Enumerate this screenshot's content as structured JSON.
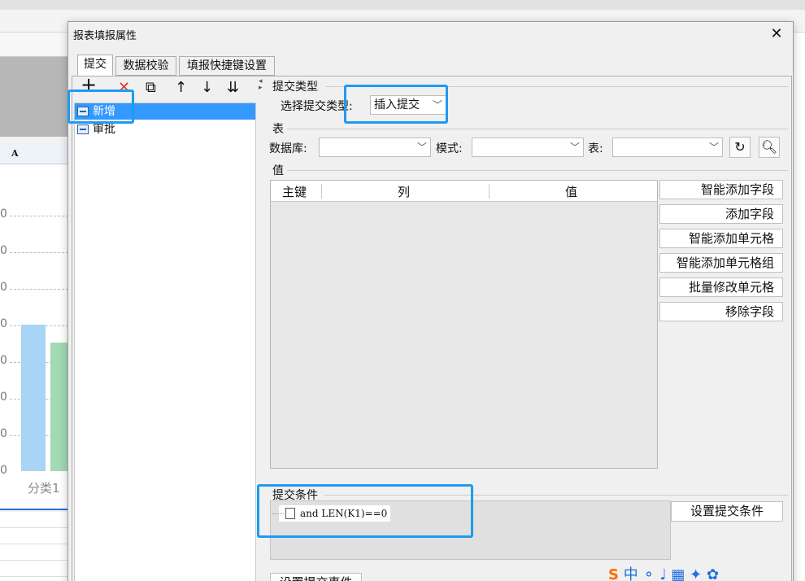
{
  "background": {
    "column_header": "A",
    "axis_ticks": [
      "0",
      "0",
      "0",
      "0",
      "0",
      "0",
      "0",
      "0"
    ],
    "category_label": "分类1"
  },
  "dialog": {
    "title": "报表填报属性",
    "close_glyph": "✕",
    "tabs": [
      "提交",
      "数据校验",
      "填报快捷键设置"
    ],
    "toolbar": {
      "add": "+",
      "delete": "✕",
      "copy": "⧉",
      "move_up": "↑",
      "move_down": "↓",
      "more": "⇊"
    },
    "list_items": [
      {
        "label": "新增",
        "selected": true
      },
      {
        "label": "审批",
        "selected": false
      }
    ],
    "submit_type": {
      "group_label": "提交类型",
      "select_label": "选择提交类型:",
      "selected": "插入提交"
    },
    "table": {
      "group_label": "表",
      "database_label": "数据库:",
      "database_value": "",
      "schema_label": "模式:",
      "schema_value": "",
      "table_label": "表:",
      "table_value": ""
    },
    "values": {
      "group_label": "值",
      "columns": [
        "主键",
        "列",
        "值"
      ]
    },
    "side_buttons": [
      "智能添加字段",
      "添加字段",
      "智能添加单元格",
      "智能添加单元格组",
      "批量修改单元格",
      "移除字段"
    ],
    "condition": {
      "group_label": "提交条件",
      "expression": "and LEN(K1)==0",
      "set_button": "设置提交条件"
    },
    "set_event_button": "设置提交事件"
  },
  "colors": {
    "highlight": "#1e9bef",
    "selection": "#3399ff"
  }
}
